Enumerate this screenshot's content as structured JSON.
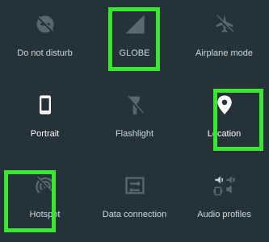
{
  "quick_settings": {
    "tiles": [
      {
        "label": "Do not disturb",
        "icon": "do-not-disturb-icon",
        "state": "off"
      },
      {
        "label": "GLOBE",
        "icon": "cellular-signal-icon",
        "state": "off"
      },
      {
        "label": "Airplane mode",
        "icon": "airplane-icon",
        "state": "off"
      },
      {
        "label": "Portrait",
        "icon": "portrait-phone-icon",
        "state": "on"
      },
      {
        "label": "Flashlight",
        "icon": "flashlight-icon",
        "state": "off"
      },
      {
        "label": "Location",
        "icon": "location-pin-icon",
        "state": "on"
      },
      {
        "label": "Hotspot",
        "icon": "hotspot-icon",
        "state": "off"
      },
      {
        "label": "Data connection",
        "icon": "data-connection-icon",
        "state": "off"
      },
      {
        "label": "Audio profiles",
        "icon": "audio-profiles-icon",
        "state": "off"
      }
    ]
  },
  "colors": {
    "background": "#263238",
    "icon_off": "#5b676d",
    "icon_on": "#ffffff",
    "label": "#cfd8dc",
    "highlight": "#39e630"
  }
}
